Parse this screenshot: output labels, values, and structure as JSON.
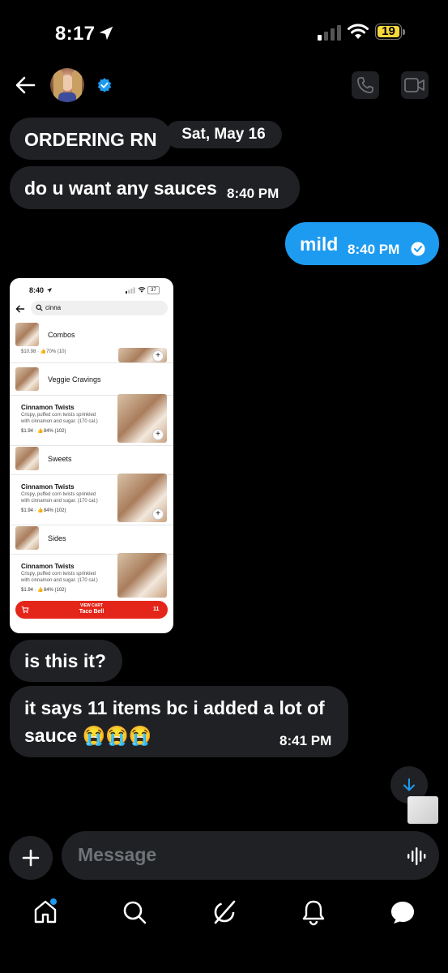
{
  "status_bar": {
    "time": "8:17",
    "battery": "19"
  },
  "header": {
    "contact_verified": true
  },
  "messages": {
    "m1": {
      "text": "ORDERING RN"
    },
    "date_chip": "Sat, May 16",
    "m2": {
      "text": "do u want any sauces",
      "time": "8:40 PM"
    },
    "m3": {
      "text": "mild",
      "time": "8:40 PM"
    },
    "m4": {
      "text": "is this it?"
    },
    "m5": {
      "text_line1": "it says 11 items bc i added a lot of",
      "text_line2": "sauce 😭😭😭",
      "time": "8:41 PM"
    }
  },
  "embedded_screenshot": {
    "time": "8:40",
    "battery": "37",
    "search_query": "cinna",
    "sections": [
      {
        "category": "Combos",
        "price_line": "$10.98 · 👍70% (10)"
      },
      {
        "category": "Veggie Cravings",
        "item": "Cinnamon Twists",
        "desc_line1": "Crispy, puffed corn twists sprinkled",
        "desc_line2": "with cinnamon and sugar. (170 cal.)",
        "price_line": "$1.94 · 👍84% (102)"
      },
      {
        "category": "Sweets",
        "item": "Cinnamon Twists",
        "desc_line1": "Crispy, puffed corn twists sprinkled",
        "desc_line2": "with cinnamon and sugar. (170 cal.)",
        "price_line": "$1.94 · 👍84% (102)"
      },
      {
        "category": "Sides",
        "item": "Cinnamon Twists",
        "desc_line1": "Crispy, puffed corn twists sprinkled",
        "desc_line2": "with cinnamon and sugar. (170 cal.)",
        "price_line": "$1.94 · 👍84% (102)"
      }
    ],
    "cart": {
      "label": "VIEW CART",
      "store": "Taco Bell",
      "count": "11"
    }
  },
  "composer": {
    "placeholder": "Message"
  },
  "colors": {
    "accent": "#1d9bf0",
    "bubble": "#202124",
    "cart_red": "#e4261a"
  },
  "icons": [
    "back-arrow-icon",
    "verified-icon",
    "phone-icon",
    "video-icon",
    "scroll-down-icon",
    "plus-icon",
    "voice-icon",
    "home-icon",
    "search-icon",
    "grok-icon",
    "bell-icon",
    "messages-icon"
  ]
}
